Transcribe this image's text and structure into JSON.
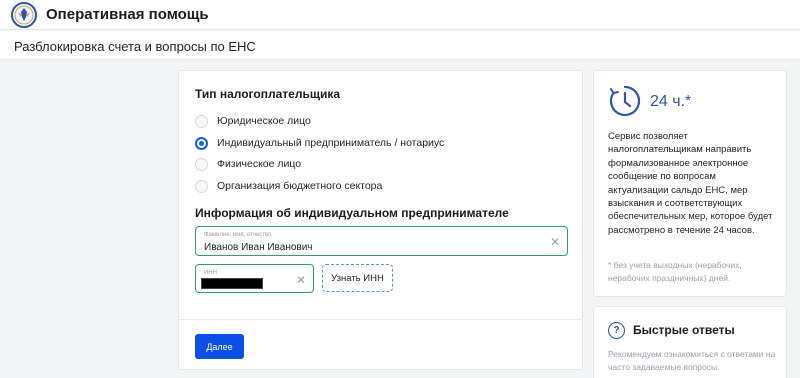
{
  "header": {
    "title": "Оперативная помощь",
    "logo_icon": "fns-emblem-icon",
    "brand_color": "#2b57a6"
  },
  "subheader": {
    "title": "Разблокировка счета и вопросы по ЕНС"
  },
  "form": {
    "taxpayer_type_title": "Тип налогоплательщика",
    "options": [
      {
        "label": "Юридическое лицо",
        "checked": false
      },
      {
        "label": "Индивидуальный предприниматель / нотариус",
        "checked": true
      },
      {
        "label": "Физическое лицо",
        "checked": false
      },
      {
        "label": "Организация бюджетного сектора",
        "checked": false
      }
    ],
    "ip_info_title": "Информация об индивидуальном предпринимателе",
    "fio": {
      "label": "Фамилия, имя, отчество",
      "value": "Иванов Иван Иванович",
      "clear_icon": "close-icon"
    },
    "inn": {
      "label": "ИНН",
      "clear_icon": "close-icon"
    },
    "inn_lookup_label": "Узнать ИНН",
    "next_label": "Далее",
    "accent_color": "#0d5bff"
  },
  "info": {
    "clock_icon": "clock-icon",
    "hours": "24 ч.*",
    "text": "Сервис позволяет налогоплательщикам направить формализованное электронное сообщение по вопросам актуализации сальдо ЕНС, мер взыскания и соответствующих обеспечительных мер, которое будет рассмотрено в течение 24 часов.",
    "note": "* без учета выходных (нерабочих, нерабочих праздничных) дней."
  },
  "quick_answers": {
    "icon": "question-icon",
    "icon_glyph": "?",
    "title": "Быстрые ответы",
    "text": "Рекомендуем ознакомиться с ответами на часто задаваемые вопросы."
  }
}
